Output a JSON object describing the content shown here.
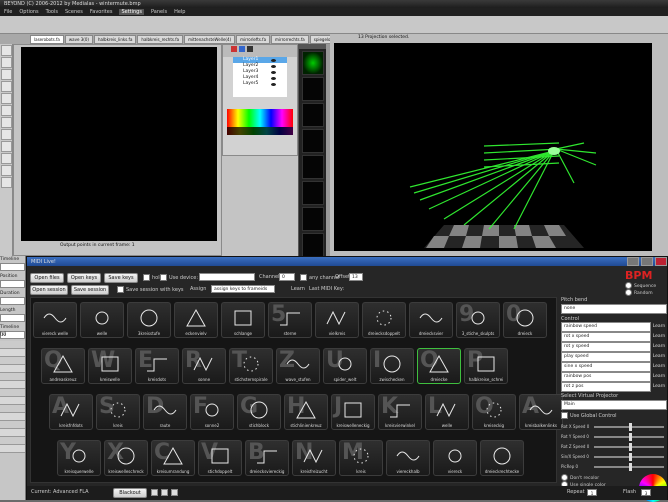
{
  "app": {
    "title": "BEYOND (C) 2006-2012 by Medialas - wintermute.bmp",
    "menu": [
      "File",
      "Options",
      "Tools",
      "Scenes",
      "Favorites",
      "Settings",
      "Panels",
      "Help"
    ],
    "active_menu": "Settings"
  },
  "tabs": [
    "laserobots.fa",
    "wave 3(0)",
    "halbkreis_links.fa",
    "halbkreis_rechts.fa",
    "mittenachsteWelle(4)",
    "mirrorlefts.fa",
    "mirrorrechts.fa",
    "spiegelobenre.fa",
    "fills_Hall.fla",
    "nls_f.ild"
  ],
  "layers": {
    "items": [
      "Layer1",
      "Layer2",
      "Layer3",
      "Layer4",
      "Layer5"
    ],
    "selected": 0
  },
  "editor": {
    "status": "Output points in current frame: 1"
  },
  "projector": {
    "title": "13 Projection selected."
  },
  "left_panel": {
    "labels": [
      "Timeline",
      "Position",
      "Duration",
      "Length",
      "Timeline [s]"
    ],
    "value": "10"
  },
  "bpm_window": {
    "title": "MIDI Live!",
    "logo": "BPM",
    "mode_options": [
      "Sequence",
      "Random"
    ],
    "row1": {
      "open_files": "Open files",
      "open_keys": "Open keys",
      "save_keys": "Save keys",
      "hold": "hold",
      "use_device": "Use device:",
      "channel_label": "Channel",
      "channel_value": "0",
      "any_channel": "any channel",
      "offset_label": "Offset",
      "offset_value": "13"
    },
    "row2": {
      "open_session": "Open session",
      "save_session": "Save session",
      "save_session_with_keys": "Save session with keys",
      "assign_label": "Assign",
      "assign_value": "assign keys to frameids",
      "learn": "Learn",
      "last_midi_key": "Last MIDI Key:"
    },
    "cue_rows": [
      [
        "viereck welle",
        "welle",
        "3kreisstufe",
        "eckenvielv",
        "schlange",
        "sterne",
        "vielkreis",
        "dreiecksdoppelt",
        "dreiecksvier",
        "3_stiche_skulpts",
        "dreieck"
      ],
      [
        "andreaskreuz",
        "kreiswelle",
        "kreisdots",
        "sonne",
        "stichsternspirale",
        "wave_stufen",
        "spider_welt",
        "zwischecken",
        "dreiecke",
        "halbkreise_schrei"
      ],
      [
        "kreisfnfdots",
        "kreis",
        "raute",
        "sonne2",
        "stichblock",
        "stichlinienkreuz",
        "kreiswelleneckig",
        "kreisvierwinkel",
        "welle",
        "kreiseckig",
        "kreisbalkenlinks"
      ],
      [
        "kreisquerwelle",
        "kreiswelleschreck",
        "kreisumrandung",
        "stichdoppelt",
        "dreiecksviereckig",
        "kreisfreizucht",
        "kreis",
        "viereckhalb",
        "viereck",
        "dreieckrechtecke"
      ]
    ],
    "cue_letters": [
      [
        "",
        "",
        "",
        "",
        "",
        "5",
        "",
        "",
        "",
        "9",
        "0"
      ],
      [
        "Q",
        "W",
        "E",
        "R",
        "T",
        "Z",
        "U",
        "I",
        "O",
        "P"
      ],
      [
        "A",
        "S",
        "D",
        "F",
        "G",
        "H",
        "J",
        "K",
        "L",
        "Ö",
        "Ä"
      ],
      [
        "Y",
        "X",
        "C",
        "V",
        "B",
        "N",
        "M",
        "",
        "",
        ""
      ]
    ],
    "selected_cue": "dreiecke",
    "right": {
      "pitch_bend_label": "Pitch bend",
      "pitch_bend_value": "none",
      "control_label": "Control",
      "controls": [
        "rainbow speed",
        "rot x speed",
        "rot y speed",
        "play speed",
        "sine x speed",
        "rainbow pos",
        "rot z pos"
      ],
      "learn": "Learn",
      "virtual_projector_label": "Select Virtual Projector",
      "virtual_projector_value": "Main",
      "use_global_control": "Use Global Control",
      "sliders": [
        "Rot X Speed 0",
        "Rot Y Speed 0",
        "Rot Z Speed 0",
        "Sin/X Speed 0",
        "PicRep 0"
      ],
      "dont_recolor": "Don't recolor",
      "use_single_color": "Use single color",
      "use_rainbow": "Use rainbow",
      "repeat_label": "Repeat",
      "repeat_value": "1",
      "flash_label": "Flash",
      "flash_value": "3"
    },
    "footer": {
      "current": "Current: Advanced FLA",
      "blackout": "Blackout"
    }
  },
  "colors": {
    "laser_green": "#35ff35",
    "selection_blue": "#5aa7e8",
    "cue_select": "#3fbf3f"
  }
}
